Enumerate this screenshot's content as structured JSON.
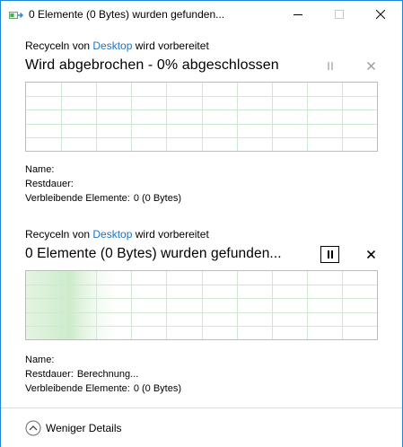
{
  "window": {
    "title": "0 Elemente (0 Bytes) wurden gefunden..."
  },
  "operations": [
    {
      "header_prefix": "Recyceln von ",
      "header_link": "Desktop",
      "header_suffix": " wird vorbereitet",
      "status": "Wird abgebrochen - 0% abgeschlossen",
      "progress_percent": 0,
      "details": {
        "name_label": "Name:",
        "name_value": "",
        "remaining_time_label": "Restdauer:",
        "remaining_time_value": "",
        "remaining_items_label": "Verbleibende Elemente:",
        "remaining_items_value": "0 (0 Bytes)"
      }
    },
    {
      "header_prefix": "Recyceln von ",
      "header_link": "Desktop",
      "header_suffix": " wird vorbereitet",
      "status": "0 Elemente (0 Bytes) wurden gefunden...",
      "progress_percent": 0,
      "details": {
        "name_label": "Name:",
        "name_value": "",
        "remaining_time_label": "Restdauer:",
        "remaining_time_value": "Berechnung...",
        "remaining_items_label": "Verbleibende Elemente:",
        "remaining_items_value": "0 (0 Bytes)"
      }
    }
  ],
  "footer": {
    "fewer_details_label": "Weniger Details"
  },
  "colors": {
    "accent": "#1e88d6",
    "link": "#1a73c8",
    "grid_line": "#cfe8d2",
    "progress_fill": "#cdeccb"
  },
  "icons": {
    "app": "copy-progress-icon",
    "minimize": "minimize-icon",
    "maximize": "maximize-icon",
    "close": "close-icon",
    "pause": "pause-icon",
    "cancel": "cancel-icon",
    "collapse": "chevron-up-circle-icon"
  }
}
